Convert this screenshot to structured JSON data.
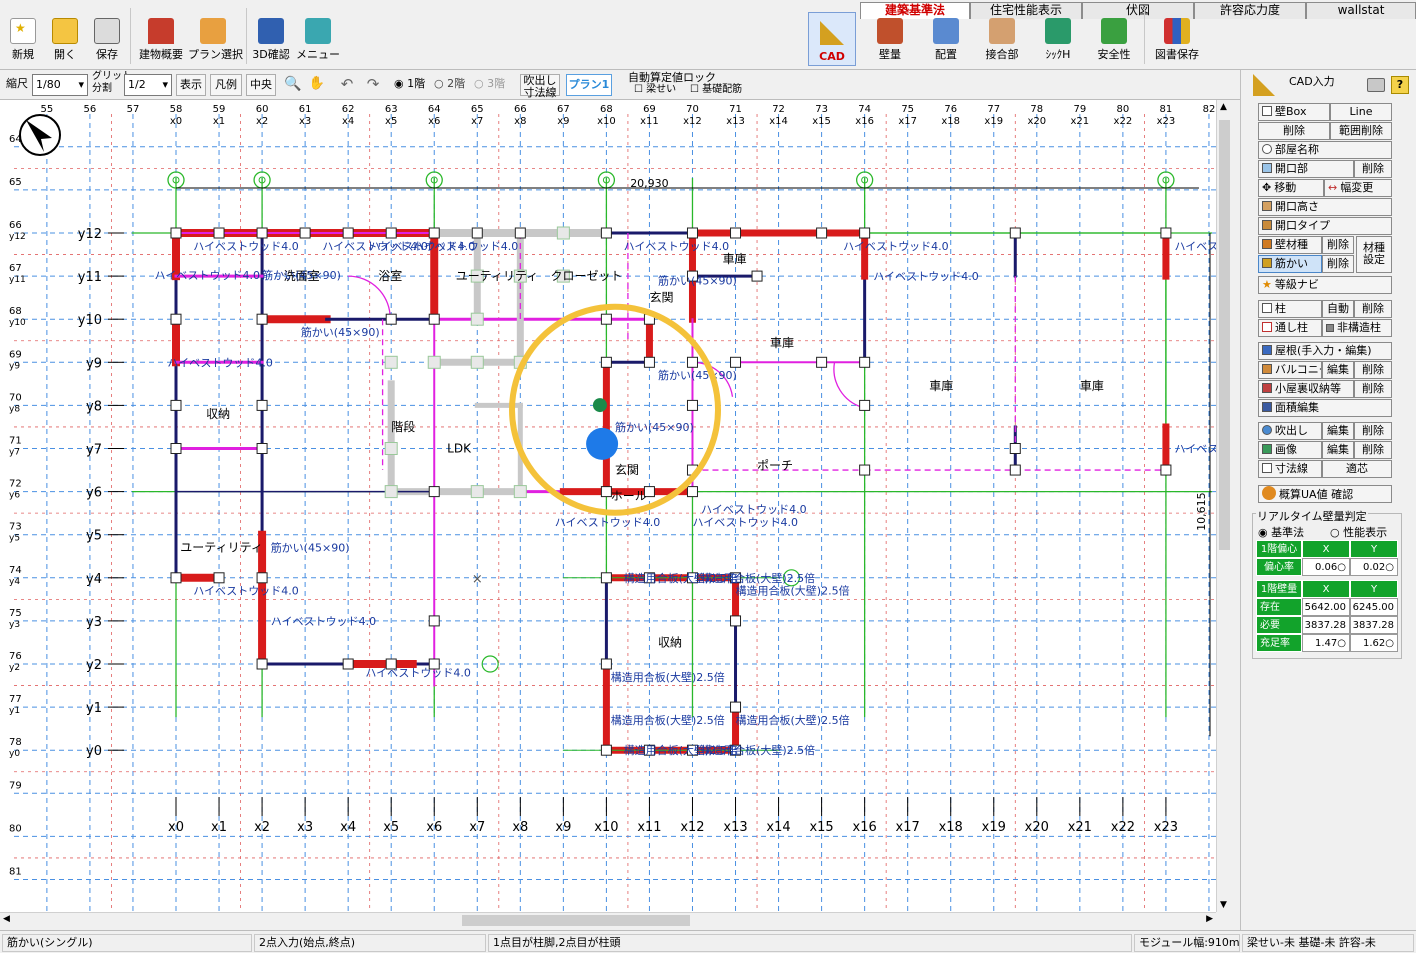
{
  "tabs": [
    {
      "label": "建築基準法",
      "active": true
    },
    {
      "label": "住宅性能表示",
      "active": false
    },
    {
      "label": "伏図",
      "active": false
    },
    {
      "label": "許容応力度",
      "active": false
    },
    {
      "label": "wallstat",
      "active": false
    }
  ],
  "toolbar": {
    "new": "新規",
    "open": "開く",
    "save": "保存",
    "building": "建物概要",
    "plan_select": "プラン選択",
    "check3d": "3D確認",
    "menu": "メニュー",
    "cad": "CAD",
    "wall": "壁量",
    "layout": "配置",
    "joint": "接合部",
    "n_value": "ｼｯｸH",
    "safety": "安全性",
    "doc_save": "図書保存"
  },
  "toolbar2": {
    "scale_label": "縮尺",
    "scale_value": "1/80",
    "grid_label1": "グリット",
    "grid_label2": "分割",
    "grid_value": "1/2",
    "display": "表示",
    "legend": "凡例",
    "center": "中央",
    "floor1": "1階",
    "floor2": "2階",
    "floor3": "3階",
    "fukinuke1": "吹出し",
    "fukinuke2": "寸法線",
    "plan1": "プラン1",
    "autolock": "自動算定値ロック",
    "beam_check": "梁せい",
    "foundation_check": "基礎配筋"
  },
  "drawing": {
    "col_numbers": [
      "55",
      "56",
      "57",
      "58",
      "59",
      "60",
      "61",
      "62",
      "63",
      "64",
      "65",
      "66",
      "67",
      "68",
      "69",
      "70",
      "71",
      "72",
      "73",
      "74",
      "75",
      "76",
      "77",
      "78",
      "79",
      "80",
      "81",
      "82"
    ],
    "x_labels": [
      "x0",
      "x1",
      "x2",
      "x3",
      "x4",
      "x5",
      "x6",
      "x7",
      "x8",
      "x9",
      "x10",
      "x11",
      "x12",
      "x13",
      "x14",
      "x15",
      "x16",
      "x17",
      "x18",
      "x19",
      "x20",
      "x21",
      "x22",
      "x23"
    ],
    "row_numbers": [
      "64",
      "65",
      "66",
      "67",
      "68",
      "69",
      "70",
      "71",
      "72",
      "73",
      "74",
      "75",
      "76",
      "77",
      "78",
      "79",
      "80",
      "81"
    ],
    "row_sub": [
      "",
      "",
      "y12",
      "y11",
      "y10",
      "y9",
      "y8",
      "y7",
      "y6",
      "y5",
      "y4",
      "y3",
      "y2",
      "y1",
      "y0",
      "",
      "",
      ""
    ],
    "y_labels": [
      "y12",
      "y11",
      "y10",
      "y9",
      "y8",
      "y7",
      "y6",
      "y5",
      "y4",
      "y3",
      "y2",
      "y1",
      "y0"
    ],
    "dim_top": "20,930",
    "dim_right": "10,615",
    "rooms": [
      "洗面室",
      "浴室",
      "ユーティリティ",
      "クローゼット",
      "玄関",
      "車庫",
      "車庫",
      "車庫",
      "車庫",
      "階段",
      "LDK",
      "収納",
      "玄関",
      "ホール",
      "ポーチ",
      "ユーティリティ",
      "収納"
    ],
    "wall_labels": [
      "ハイベストウッド4.0",
      "ハイベストウッド4.0",
      "ハイベストウッド4.0",
      "ハイベストウッド4.0",
      "ハイベストウッド4.0",
      "ハイベストウッド4.0",
      "ハイベストウッド4.0",
      "ハイベストウッド4.0",
      "ハイベストウッド4.0",
      "ハイベストウッド4.0",
      "ハイベストウッド4.0",
      "ハイベストウッド4.0",
      "ハイベストウッド4.0",
      "ハイベストウッド4.0"
    ],
    "brace_labels": [
      "筋かい(45×90)",
      "筋かい(45×90)",
      "筋かい(45×90)",
      "筋かい(45×90)",
      "筋かい(45×90)",
      "筋かい(45×90)"
    ],
    "plywood_labels": [
      "構造用合板(大壁)2.5倍",
      "構造用合板(大壁)2.5倍",
      "構造用合板(大壁)2.5倍",
      "構造用合板(大壁)2.5倍",
      "構造用合板(大壁)2.5倍",
      "構造用合板(大壁)2.5倍",
      "構造用合板(大壁)2.5倍",
      "構造用合板(大壁)2.5倍"
    ]
  },
  "panel": {
    "cad_input": "CAD入力",
    "wallbox": "壁Box",
    "line": "Line",
    "delete": "削除",
    "range_delete": "範囲削除",
    "room_name": "部屋名称",
    "opening": "開口部",
    "move": "移動",
    "width_change": "幅変更",
    "opening_height": "開口高さ",
    "opening_type": "開口タイプ",
    "wall_material": "壁材種",
    "brace": "筋かい",
    "material_setting1": "材種",
    "material_setting2": "設定",
    "grade_navi": "等級ナビ",
    "column": "柱",
    "auto": "自動",
    "through_column": "通し柱",
    "non_structural": "非構造柱",
    "roof": "屋根(手入力・編集)",
    "balcony": "バルコニー",
    "edit": "編集",
    "attic": "小屋裏収納等",
    "area_edit": "面積編集",
    "fukinuke": "吹出し",
    "image": "画像",
    "dim_line": "寸法線",
    "tekigo": "適芯",
    "ua_check": "概算UA値 確認",
    "realtime": "リアルタイム壁量判定",
    "mode_std": "基準法",
    "mode_perf": "性能表示"
  },
  "judge_table": {
    "ecc_title": "1階偏心",
    "x": "X",
    "y": "Y",
    "ecc_label": "偏心率",
    "ecc_x": "0.06",
    "ecc_y": "0.02",
    "wall_title": "1階壁量",
    "exist_label": "存在",
    "exist_x": "5642.00",
    "exist_y": "6245.00",
    "need_label": "必要",
    "need_x": "3837.28",
    "need_y": "3837.28",
    "ratio_label": "充足率",
    "ratio_x": "1.47",
    "ratio_y": "1.62",
    "ok_mark": "○"
  },
  "status": {
    "mode": "筋かい(シングル)",
    "input": "2点入力(始点,終点)",
    "hint": "1点目が柱脚,2点目が柱頭",
    "module": "モジュール幅:910mm",
    "extra": "梁せい-未 基礎-未 許容-未"
  }
}
